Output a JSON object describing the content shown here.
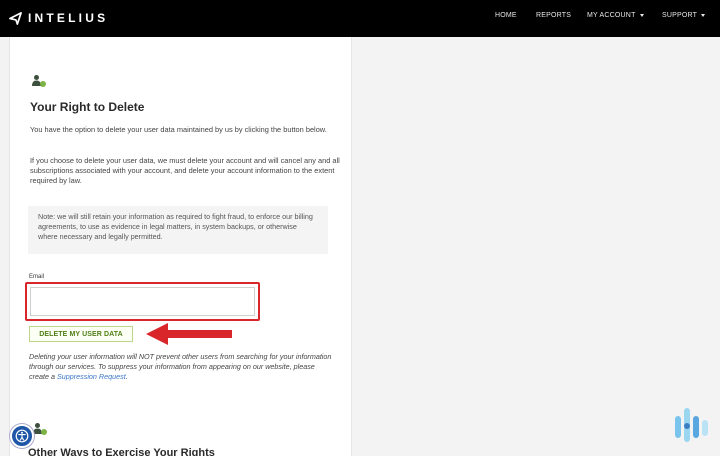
{
  "nav": {
    "brand": "INTELIUS",
    "links": {
      "home": "HOME",
      "reports": "REPORTS",
      "my_account": "MY ACCOUNT",
      "support": "SUPPORT"
    }
  },
  "content": {
    "title": "Your Right to Delete",
    "intro": "You have the option to delete your user data maintained by us by clicking the button below.",
    "consequence": "If you choose to delete your user data, we must delete your account and will cancel any and all subscriptions associated with your account, and delete your account information to the extent required by law.",
    "note": "Note: we will still retain your information as required to fight fraud, to enforce our billing agreements, to use as evidence in legal matters, in system backups, or otherwise where necessary and legally permitted.",
    "email": {
      "label": "Email",
      "value": "",
      "placeholder": ""
    },
    "delete_button": "DELETE MY USER DATA",
    "disclaimer_pre": "Deleting your user information will ",
    "disclaimer_not": "NOT",
    "disclaimer_post": " prevent other users from searching for your information through our services. To suppress your information from appearing on our website, please create a ",
    "suppression_link": "Suppression Request",
    "disclaimer_end": ".",
    "next_heading": "Other Ways to Exercise Your Rights"
  },
  "icons": {
    "person": "person-check-icon",
    "accessibility": "accessibility-icon",
    "watermark": "brand-watermark-icon"
  },
  "colors": {
    "nav_bg": "#000000",
    "highlight_red": "#d8262a",
    "button_green": "#4f7f17",
    "link_blue": "#3a77c9"
  }
}
